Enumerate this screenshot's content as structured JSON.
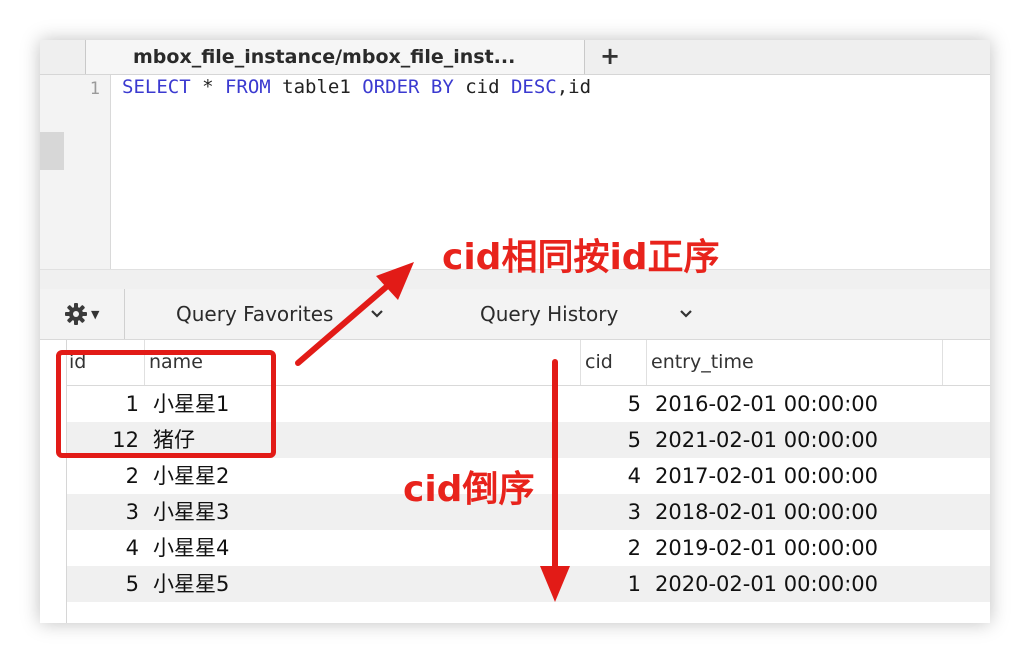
{
  "tab": {
    "title": "mbox_file_instance/mbox_file_inst...",
    "add_label": "+"
  },
  "editor": {
    "line_number": "1",
    "query_tokens": [
      {
        "text": "SELECT",
        "kw": true
      },
      {
        "text": " * ",
        "kw": false
      },
      {
        "text": "FROM",
        "kw": true
      },
      {
        "text": " table1 ",
        "kw": false
      },
      {
        "text": "ORDER BY",
        "kw": true
      },
      {
        "text": " cid ",
        "kw": false
      },
      {
        "text": "DESC",
        "kw": true
      },
      {
        "text": ",id",
        "kw": false
      }
    ]
  },
  "toolbar": {
    "query_favorites": "Query Favorites",
    "query_history": "Query History",
    "gear_icon": "gear-icon"
  },
  "results": {
    "columns": [
      "id",
      "name",
      "cid",
      "entry_time"
    ],
    "rows": [
      {
        "id": "1",
        "name": "小星星1",
        "cid": "5",
        "entry_time": "2016-02-01 00:00:00"
      },
      {
        "id": "12",
        "name": "猪仔",
        "cid": "5",
        "entry_time": "2021-02-01 00:00:00"
      },
      {
        "id": "2",
        "name": "小星星2",
        "cid": "4",
        "entry_time": "2017-02-01 00:00:00"
      },
      {
        "id": "3",
        "name": "小星星3",
        "cid": "3",
        "entry_time": "2018-02-01 00:00:00"
      },
      {
        "id": "4",
        "name": "小星星4",
        "cid": "2",
        "entry_time": "2019-02-01 00:00:00"
      },
      {
        "id": "5",
        "name": "小星星5",
        "cid": "1",
        "entry_time": "2020-02-01 00:00:00"
      }
    ]
  },
  "annotations": {
    "cid_same_label": "cid相同按id正序",
    "cid_desc_label": "cid倒序",
    "color": "#e8231c"
  }
}
